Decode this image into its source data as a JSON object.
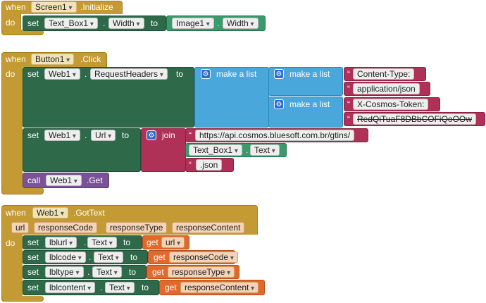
{
  "screen_init": {
    "when": "when",
    "component": "Screen1",
    "event": ".Initialize",
    "do": "do",
    "set": "set",
    "target_component": "Text_Box1",
    "target_prop": "Width",
    "to": "to",
    "source_component": "Image1",
    "source_prop": "Width",
    "dot": "."
  },
  "button_click": {
    "when": "when",
    "component": "Button1",
    "event": ".Click",
    "do": "do",
    "set1": "set",
    "web": "Web1",
    "prop1": "RequestHeaders",
    "to1": "to",
    "make_list": "make a list",
    "str_content_type": "Content-Type:",
    "str_app_json": "application/json",
    "str_token_key": "X-Cosmos-Token:",
    "str_token_val": "RedQiTuaF8DBbCOFiQoOOw",
    "set2": "set",
    "prop2": "Url",
    "to2": "to",
    "join": "join",
    "str_url": "https://api.cosmos.bluesoft.com.br/gtins/",
    "text_box": "Text_Box1",
    "text_prop": "Text",
    "str_json": ".json",
    "call": "call",
    "call_method": ".Get",
    "dot": "."
  },
  "got_text": {
    "when": "when",
    "component": "Web1",
    "event": ".GotText",
    "params": [
      "url",
      "responseCode",
      "responseType",
      "responseContent"
    ],
    "do": "do",
    "rows": [
      {
        "set": "set",
        "label": "lblurl",
        "prop": "Text",
        "to": "to",
        "get": "get",
        "var": "url"
      },
      {
        "set": "set",
        "label": "lblcode",
        "prop": "Text",
        "to": "to",
        "get": "get",
        "var": "responseCode"
      },
      {
        "set": "set",
        "label": "lbltype",
        "prop": "Text",
        "to": "to",
        "get": "get",
        "var": "responseType"
      },
      {
        "set": "set",
        "label": "lblcontent",
        "prop": "Text",
        "to": "to",
        "get": "get",
        "var": "responseContent"
      }
    ],
    "dot": "."
  },
  "colors": {
    "event": "#c39a33",
    "set_dark": "#2e6a49",
    "set_light": "#3a9a6c",
    "list": "#4aa7dc",
    "text": "#b03158",
    "call": "#7a5296",
    "get": "#e0692c"
  },
  "quote": "“"
}
